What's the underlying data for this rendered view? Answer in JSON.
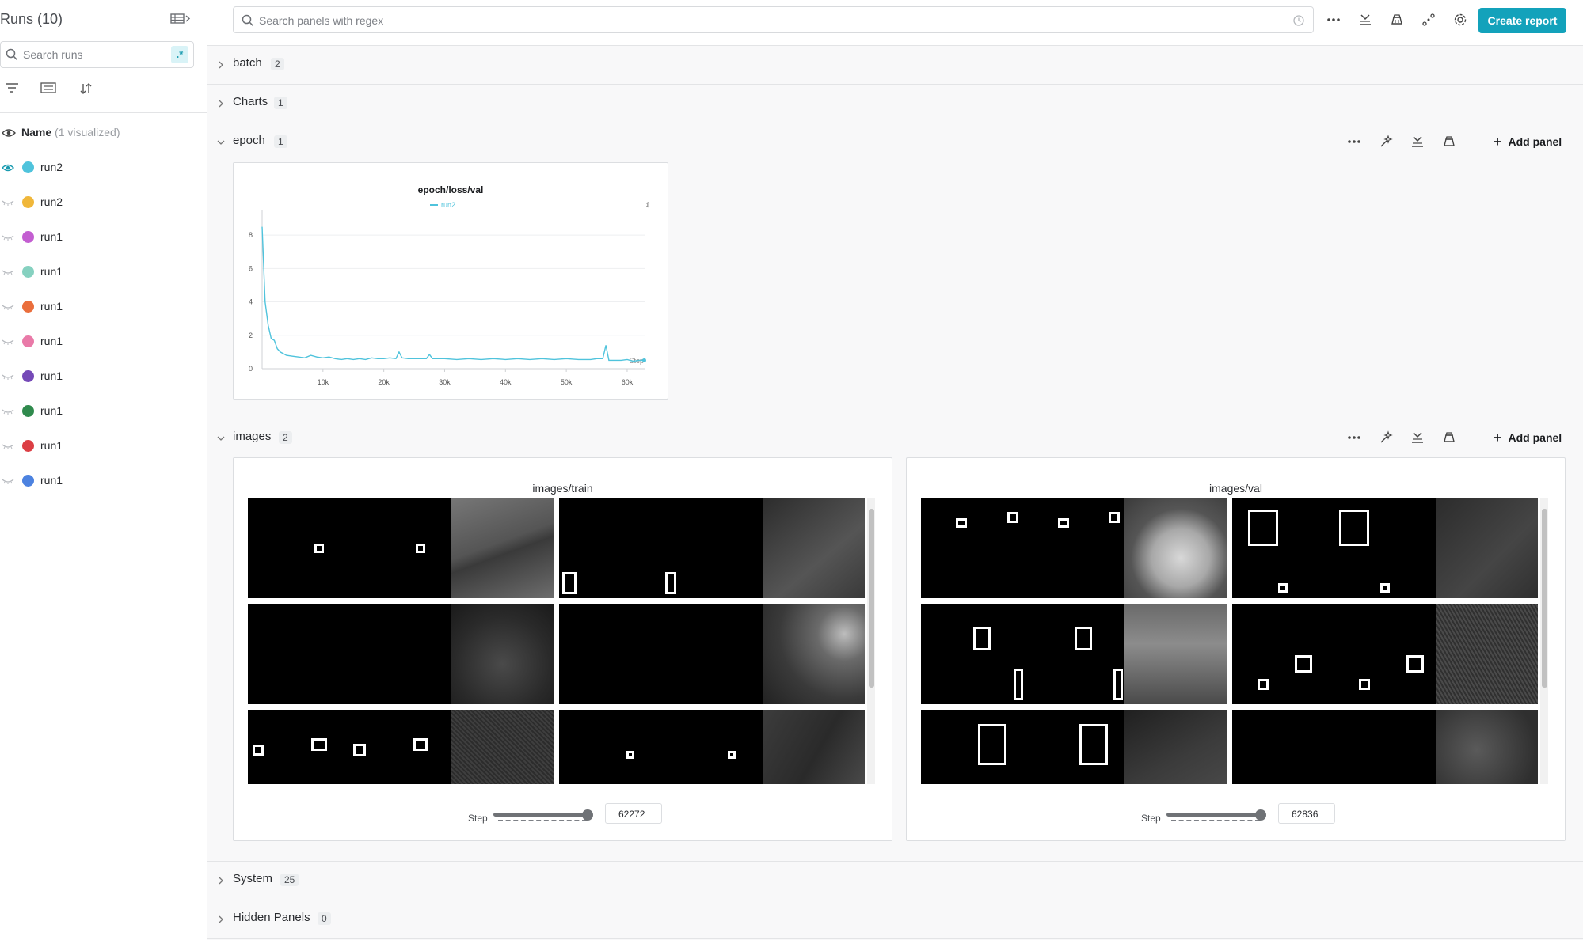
{
  "sidebar": {
    "title": "Runs (10)",
    "search_placeholder": "Search runs",
    "regex_label": ".*",
    "name_header": "Name",
    "name_header_sub": "(1 visualized)",
    "runs": [
      {
        "name": "run2",
        "color": "#4fc3dc",
        "visible": true
      },
      {
        "name": "run2",
        "color": "#f0b73a",
        "visible": false
      },
      {
        "name": "run1",
        "color": "#c35ed1",
        "visible": false
      },
      {
        "name": "run1",
        "color": "#86d1c0",
        "visible": false
      },
      {
        "name": "run1",
        "color": "#ea6e3c",
        "visible": false
      },
      {
        "name": "run1",
        "color": "#e97aa8",
        "visible": false
      },
      {
        "name": "run1",
        "color": "#7549b7",
        "visible": false
      },
      {
        "name": "run1",
        "color": "#2f8a4d",
        "visible": false
      },
      {
        "name": "run1",
        "color": "#dc3e44",
        "visible": false
      },
      {
        "name": "run1",
        "color": "#4c82e0",
        "visible": false
      }
    ]
  },
  "topbar": {
    "search_placeholder": "Search panels with regex",
    "create_report_label": "Create report",
    "accent": "#13a2bb"
  },
  "sections": {
    "batch": {
      "title": "batch",
      "count": "2"
    },
    "charts": {
      "title": "Charts",
      "count": "1"
    },
    "epoch": {
      "title": "epoch",
      "count": "1",
      "add_panel": "Add panel"
    },
    "images": {
      "title": "images",
      "count": "2",
      "add_panel": "Add panel"
    },
    "system": {
      "title": "System",
      "count": "25"
    },
    "hidden": {
      "title": "Hidden Panels",
      "count": "0"
    }
  },
  "chart_data": {
    "type": "line",
    "title": "epoch/loss/val",
    "xlabel": "Step",
    "ylabel": "",
    "xlim": [
      0,
      63000
    ],
    "ylim": [
      0,
      9
    ],
    "xticks": [
      "10k",
      "20k",
      "30k",
      "40k",
      "50k",
      "60k"
    ],
    "yticks": [
      "0",
      "2",
      "4",
      "6",
      "8"
    ],
    "grid": true,
    "legend": "top-center",
    "series": [
      {
        "name": "run2",
        "color": "#4fc3dc",
        "x": [
          0,
          500,
          1000,
          1500,
          2000,
          2500,
          3000,
          3500,
          4000,
          5000,
          6000,
          7000,
          8000,
          9000,
          10000,
          11000,
          12000,
          13000,
          14000,
          15000,
          16000,
          17000,
          18000,
          19000,
          20000,
          21000,
          22000,
          22500,
          23000,
          24000,
          25000,
          26000,
          27000,
          27500,
          28000,
          29000,
          30000,
          32000,
          34000,
          36000,
          38000,
          40000,
          42000,
          44000,
          46000,
          48000,
          50000,
          52000,
          54000,
          55000,
          56000,
          56500,
          57000,
          58000,
          59000,
          60000,
          61000,
          62000,
          62800
        ],
        "y": [
          8.5,
          4.0,
          2.6,
          1.8,
          1.7,
          1.2,
          1.0,
          0.9,
          0.8,
          0.75,
          0.7,
          0.65,
          0.8,
          0.7,
          0.65,
          0.7,
          0.6,
          0.55,
          0.6,
          0.55,
          0.6,
          0.55,
          0.65,
          0.6,
          0.6,
          0.65,
          0.6,
          1.0,
          0.65,
          0.6,
          0.6,
          0.6,
          0.6,
          0.85,
          0.6,
          0.6,
          0.6,
          0.55,
          0.6,
          0.55,
          0.6,
          0.55,
          0.6,
          0.55,
          0.6,
          0.55,
          0.6,
          0.55,
          0.55,
          0.6,
          0.6,
          1.4,
          0.5,
          0.5,
          0.5,
          0.55,
          0.45,
          0.5,
          0.5
        ]
      }
    ]
  },
  "images_panels": {
    "train": {
      "title": "images/train",
      "step_label": "Step",
      "step_value": "62272"
    },
    "val": {
      "title": "images/val",
      "step_label": "Step",
      "step_value": "62836"
    }
  }
}
